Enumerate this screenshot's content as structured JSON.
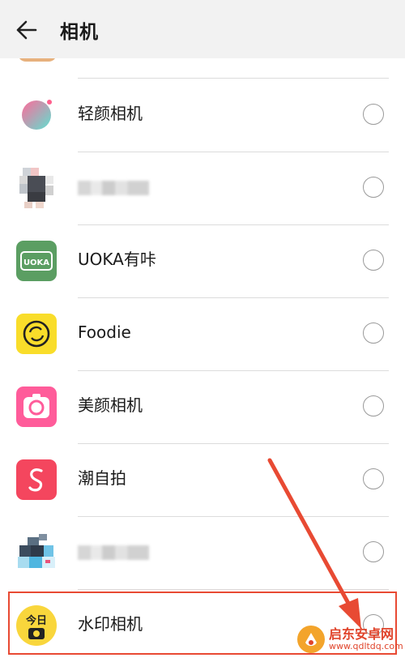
{
  "header": {
    "title": "相机",
    "back_icon": "arrow-left-icon"
  },
  "apps": [
    {
      "name": "轻颜相机",
      "icon": "qingyan-camera-icon",
      "selected": false
    },
    {
      "name": "",
      "icon": "pixelated-app-icon",
      "obscured": true,
      "selected": false
    },
    {
      "name": "UOKA有咔",
      "icon": "uoka-icon",
      "icon_text": "UOKA",
      "selected": false
    },
    {
      "name": "Foodie",
      "icon": "foodie-icon",
      "selected": false
    },
    {
      "name": "美颜相机",
      "icon": "meiyan-camera-icon",
      "selected": false
    },
    {
      "name": "潮自拍",
      "icon": "chaozipai-icon",
      "selected": false
    },
    {
      "name": "",
      "icon": "pixelated-app-icon",
      "obscured": true,
      "selected": false
    },
    {
      "name": "水印相机",
      "icon": "watermark-camera-icon",
      "icon_text": "今日",
      "selected": false,
      "highlighted": true
    }
  ],
  "watermark": {
    "line1": "启东安卓网",
    "line2": "www.qdltdq.com"
  },
  "colors": {
    "highlight": "#e84a33",
    "header_bg": "#f2f2f2",
    "divider": "#dcdcdc"
  }
}
